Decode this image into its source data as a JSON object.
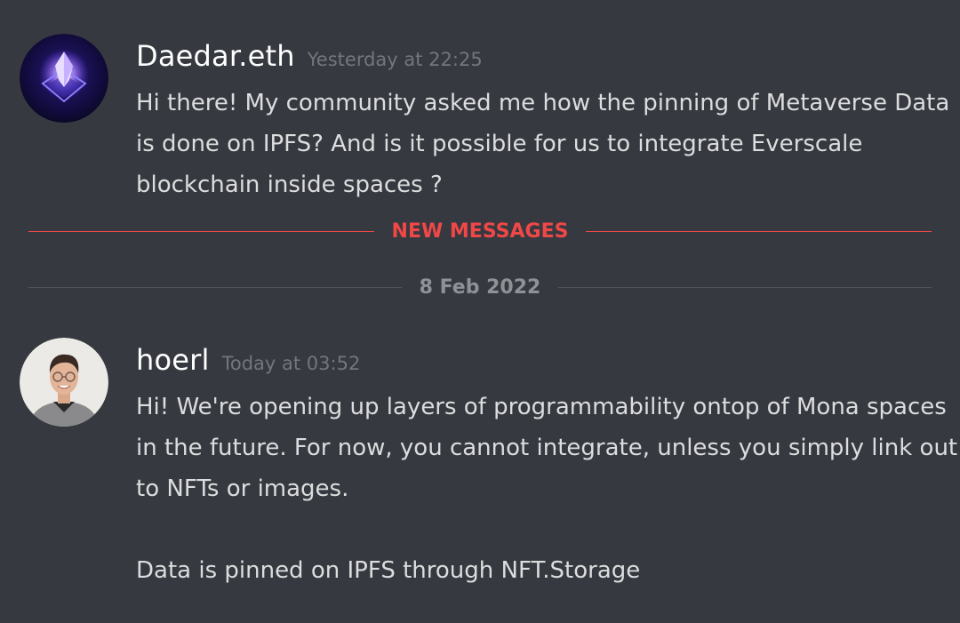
{
  "messages": [
    {
      "username": "Daedar.eth",
      "timestamp": "Yesterday at 22:25",
      "lines": [
        "Hi there! My community asked me how the pinning of Metaverse Data is done on IPFS? And is it possible for us to integrate Everscale blockchain inside spaces ?"
      ],
      "avatar_icon": "purple-crystal-avatar"
    },
    {
      "username": "hoerl",
      "timestamp": "Today at 03:52",
      "lines": [
        "Hi! We're opening up layers of programmability ontop of Mona spaces in the future. For now, you cannot integrate, unless you simply link out to NFTs or images.",
        "Data is pinned on IPFS through NFT.Storage"
      ],
      "avatar_icon": "user-photo-avatar"
    }
  ],
  "dividers": {
    "new_messages": "NEW MESSAGES",
    "date": "8 Feb 2022"
  },
  "colors": {
    "background": "#36393f",
    "new_messages": "#f04747",
    "timestamp": "#72767d"
  }
}
